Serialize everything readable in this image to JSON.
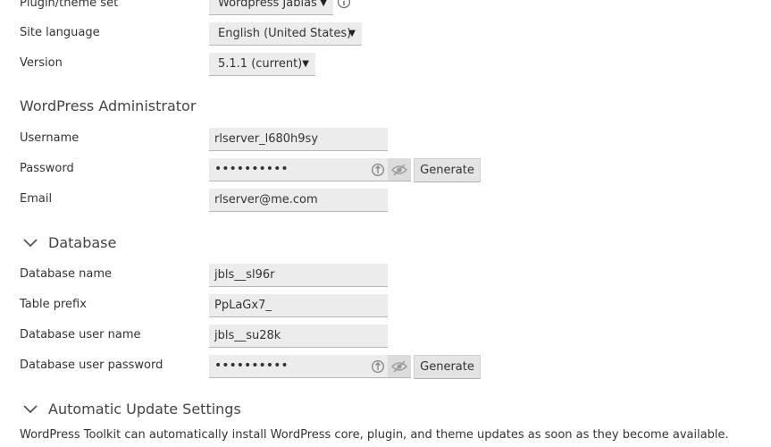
{
  "plugin_theme_set": {
    "label": "Plugin/theme set",
    "value": "Wordpress Jablas"
  },
  "site_language": {
    "label": "Site language",
    "value": "English (United States)"
  },
  "version": {
    "label": "Version",
    "value": "5.1.1 (current)"
  },
  "admin_section": {
    "title": "WordPress Administrator",
    "username": {
      "label": "Username",
      "value": "rlserver_l680h9sy"
    },
    "password": {
      "label": "Password",
      "value": "••••••••••",
      "generate_label": "Generate"
    },
    "email": {
      "label": "Email",
      "value": "rlserver@me.com"
    }
  },
  "database_section": {
    "title": "Database",
    "db_name": {
      "label": "Database name",
      "value": "jbls__sl96r"
    },
    "table_prefix": {
      "label": "Table prefix",
      "value": "PpLaGx7_"
    },
    "db_user": {
      "label": "Database user name",
      "value": "jbls__su28k"
    },
    "db_password": {
      "label": "Database user password",
      "value": "••••••••••",
      "generate_label": "Generate"
    }
  },
  "auto_update_section": {
    "title": "Automatic Update Settings",
    "description": "WordPress Toolkit can automatically install WordPress core, plugin, and theme updates as soon as they become available."
  },
  "icons": {
    "info": "info-icon",
    "strength": "password-strength-icon",
    "eye": "eye-slash-icon",
    "chevron": "chevron-down-icon"
  }
}
